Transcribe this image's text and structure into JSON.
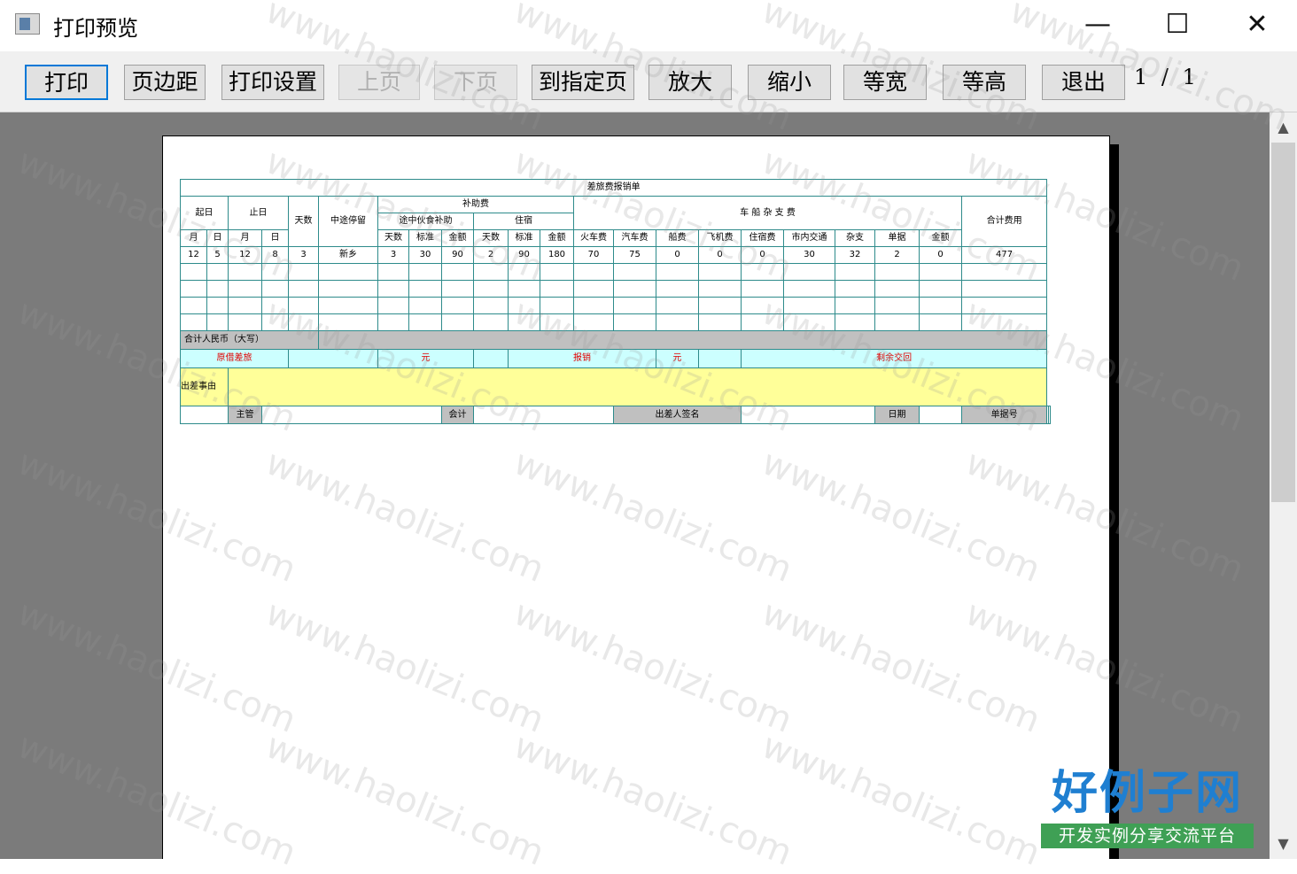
{
  "window": {
    "title": "打印预览",
    "minimize": "—",
    "maximize": "☐",
    "close": "✕"
  },
  "toolbar": {
    "print": "打印",
    "margins": "页边距",
    "print_setup": "打印设置",
    "prev_page": "上页",
    "next_page": "下页",
    "goto_page": "到指定页",
    "zoom_in": "放大",
    "zoom_out": "缩小",
    "fit_width": "等宽",
    "fit_height": "等高",
    "exit": "退出",
    "page_current": "1",
    "page_sep": "/",
    "page_total": "1"
  },
  "sheet": {
    "title": "差旅费报销单",
    "h_start": "起日",
    "h_end": "止日",
    "h_days": "天数",
    "h_stops": "中途停留",
    "h_allowance": "补助费",
    "h_vehicle": "车 船 杂 支 费",
    "h_total": "合计费用",
    "h_meal": "途中伙食补助",
    "h_lodging": "住宿",
    "h_month": "月",
    "h_day": "日",
    "h_month2": "月",
    "h_day2": "日",
    "h_d_days": "天数",
    "h_d_std": "标准",
    "h_d_amt": "金额",
    "h_l_days": "天数",
    "h_l_std": "标准",
    "h_l_amt": "金额",
    "h_train": "火车费",
    "h_bus": "汽车费",
    "h_ship": "船费",
    "h_plane": "飞机费",
    "h_hotel": "住宿费",
    "h_city": "市内交通",
    "h_misc": "杂支",
    "h_docs": "单据",
    "h_v_amt": "金额",
    "row": {
      "start_month": "12",
      "start_day": "5",
      "end_month": "12",
      "end_day": "8",
      "days": "3",
      "stop": "新乡",
      "meal_days": "3",
      "meal_std": "30",
      "meal_amt": "90",
      "lodge_days": "2",
      "lodge_std": "90",
      "lodge_amt": "180",
      "train": "70",
      "bus": "75",
      "ship": "0",
      "plane": "0",
      "hotel": "0",
      "city": "30",
      "misc": "32",
      "docs": "2",
      "vamt": "0",
      "total": "477"
    },
    "total_label": "合计人民币（大写）",
    "advance_label": "原借差旅",
    "yuan1": "元",
    "reimburse_label": "报销",
    "yuan2": "元",
    "refund_label": "剩余交回",
    "reason_label": "出差事由",
    "sign_supervisor": "主管",
    "sign_accountant": "会计",
    "sign_traveler": "出差人签名",
    "sign_date": "日期",
    "sign_docs": "单据号"
  },
  "watermark": "www.haolizi.com",
  "logo": {
    "main": "好例子网",
    "sub": "开发实例分享交流平台"
  }
}
